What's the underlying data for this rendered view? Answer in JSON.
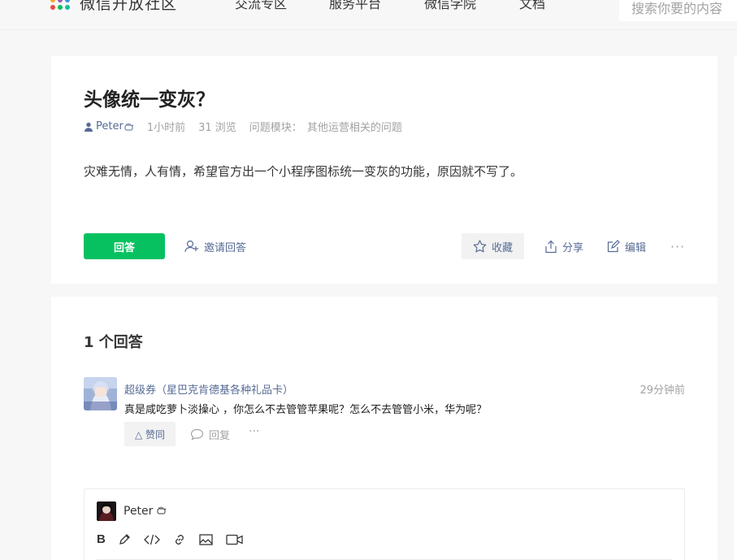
{
  "nav": {
    "logo_text": "微信开放社区",
    "links": [
      "交流专区",
      "服务平台",
      "微信学院",
      "文档"
    ],
    "search_placeholder": "搜索你要的内容"
  },
  "question": {
    "title": "头像统一变灰？",
    "author": "Peter",
    "time": "1小时前",
    "views": "31 浏览",
    "module_label": "问题模块：",
    "module": "其他运营相关的问题",
    "body": "灾难无情，人有情，希望官方出一个小程序图标统一变灰的功能，原因就不写了。",
    "answer_btn": "回答",
    "invite_label": "邀请回答",
    "fav_label": "收藏",
    "share_label": "分享",
    "edit_label": "编辑",
    "more": "···"
  },
  "answers": {
    "count_label": "1 个回答",
    "items": [
      {
        "name": "超级券（星巴克肯德基各种礼品卡）",
        "time": "29分钟前",
        "text": "真是咸吃萝卜淡操心 ，你怎么不去管管苹果呢？怎么不去管管小米，华为呢？",
        "like_label": "△ 赞同",
        "reply_label": "回复",
        "more": "···"
      }
    ]
  },
  "editor": {
    "user": "Peter",
    "tools": [
      "B"
    ]
  },
  "colors": {
    "accent": "#07c160",
    "link": "#576b95",
    "muted": "#a3a3a3"
  }
}
